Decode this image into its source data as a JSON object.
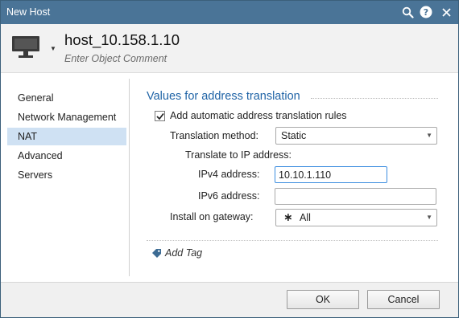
{
  "window": {
    "title": "New Host"
  },
  "header": {
    "object_name": "host_10.158.1.10",
    "comment_placeholder": "Enter Object Comment"
  },
  "sidebar": {
    "items": [
      {
        "label": "General",
        "active": false
      },
      {
        "label": "Network Management",
        "active": false
      },
      {
        "label": "NAT",
        "active": true
      },
      {
        "label": "Advanced",
        "active": false
      },
      {
        "label": "Servers",
        "active": false
      }
    ]
  },
  "nat": {
    "section_title": "Values for address translation",
    "auto_rules_label": "Add automatic address translation rules",
    "auto_rules_checked": true,
    "method_label": "Translation method:",
    "method_value": "Static",
    "translate_to_label": "Translate to IP address:",
    "ipv4_label": "IPv4 address:",
    "ipv4_value": "10.10.1.110",
    "ipv6_label": "IPv6 address:",
    "ipv6_value": "",
    "gateway_label": "Install on gateway:",
    "gateway_value": "All",
    "gateway_icon": "asterisk-icon"
  },
  "tags": {
    "add_label": "Add Tag"
  },
  "footer": {
    "ok_label": "OK",
    "cancel_label": "Cancel"
  },
  "colors": {
    "titlebar": "#4a7497",
    "section_title": "#1f63a6",
    "nav_active": "#cfe1f3",
    "focus": "#3d8ee0"
  }
}
